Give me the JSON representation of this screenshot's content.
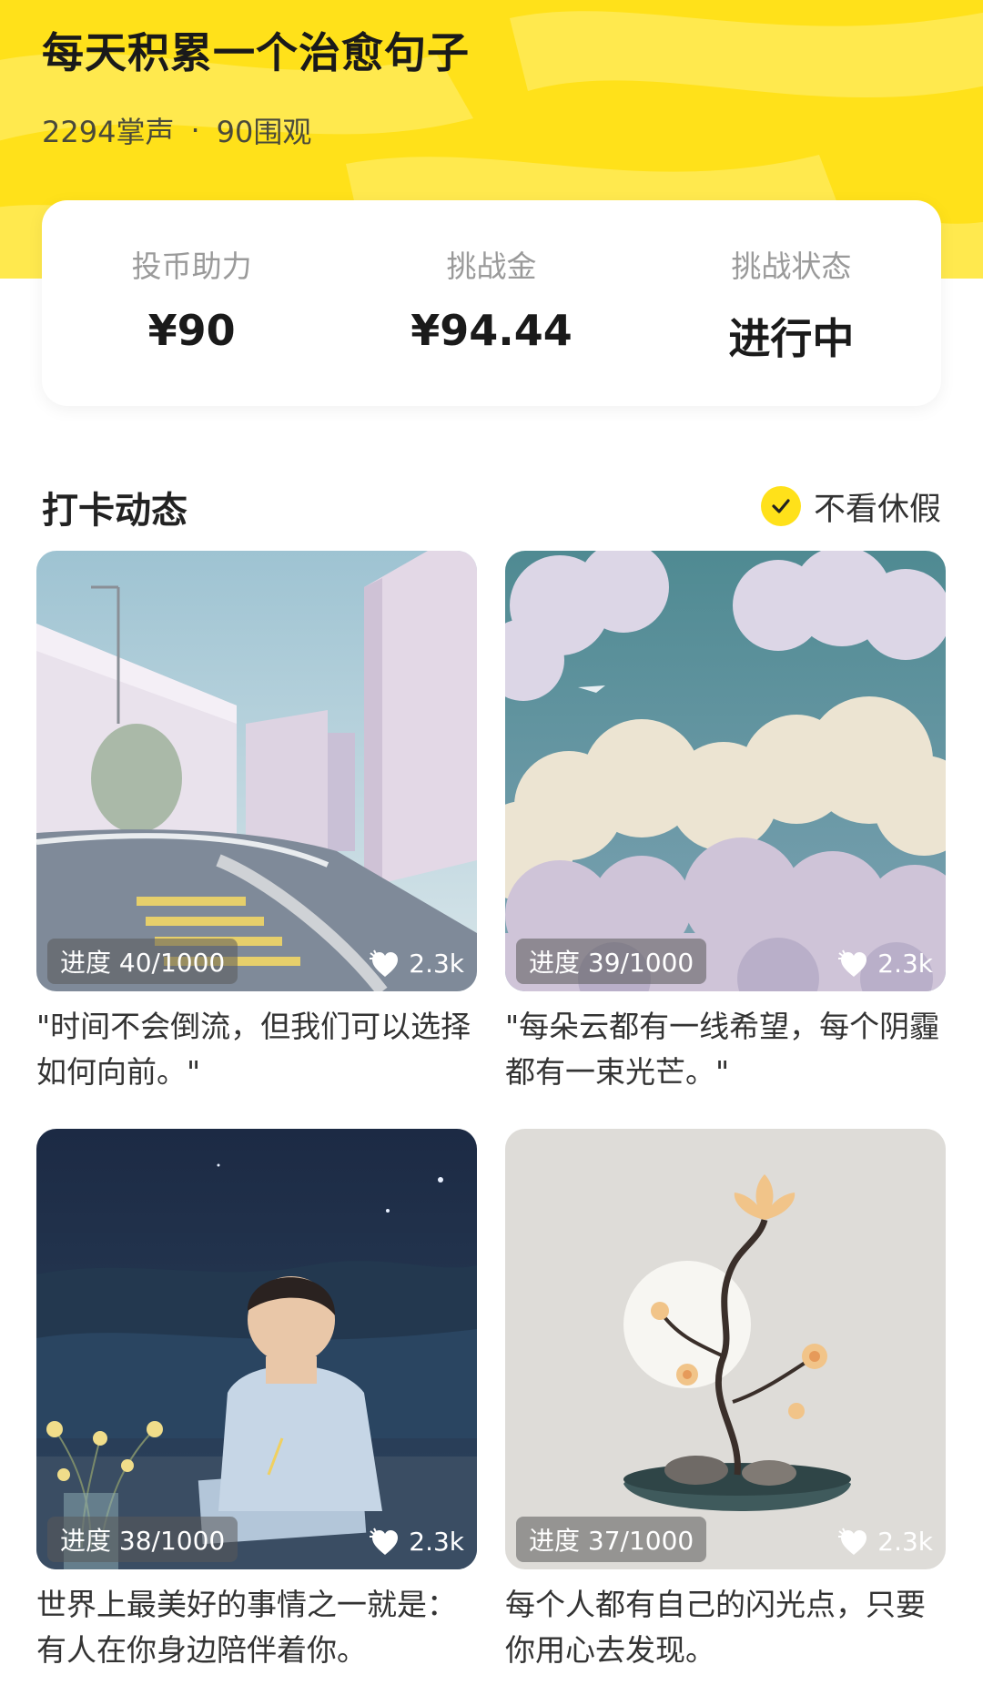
{
  "header": {
    "title": "每天积累一个治愈句子",
    "applause": "2294掌声",
    "separator": "·",
    "views": "90围观"
  },
  "stats": [
    {
      "label": "投币助力",
      "value": "¥90"
    },
    {
      "label": "挑战金",
      "value": "¥94.44"
    },
    {
      "label": "挑战状态",
      "value": "进行中"
    }
  ],
  "section": {
    "title": "打卡动态",
    "filter_label": "不看休假",
    "filter_checked": true
  },
  "cards": [
    {
      "progress": "进度 40/1000",
      "likes": "2.3k",
      "caption": "\"时间不会倒流，但我们可以选择如何向前。\"",
      "image": "road-city-illustration"
    },
    {
      "progress": "进度 39/1000",
      "likes": "2.3k",
      "caption": "\"每朵云都有一线希望，每个阴霾都有一束光芒。\"",
      "image": "clouds-sky-illustration"
    },
    {
      "progress": "进度 38/1000",
      "likes": "2.3k",
      "caption": "世界上最美好的事情之一就是：有人在你身边陪伴着你。",
      "image": "boy-writing-night-illustration"
    },
    {
      "progress": "进度 37/1000",
      "likes": "2.3k",
      "caption": "每个人都有自己的闪光点，只要你用心去发现。",
      "image": "lotus-bonsai-illustration"
    }
  ],
  "colors": {
    "accent": "#ffe11a",
    "accent_dark": "#ffd400"
  }
}
